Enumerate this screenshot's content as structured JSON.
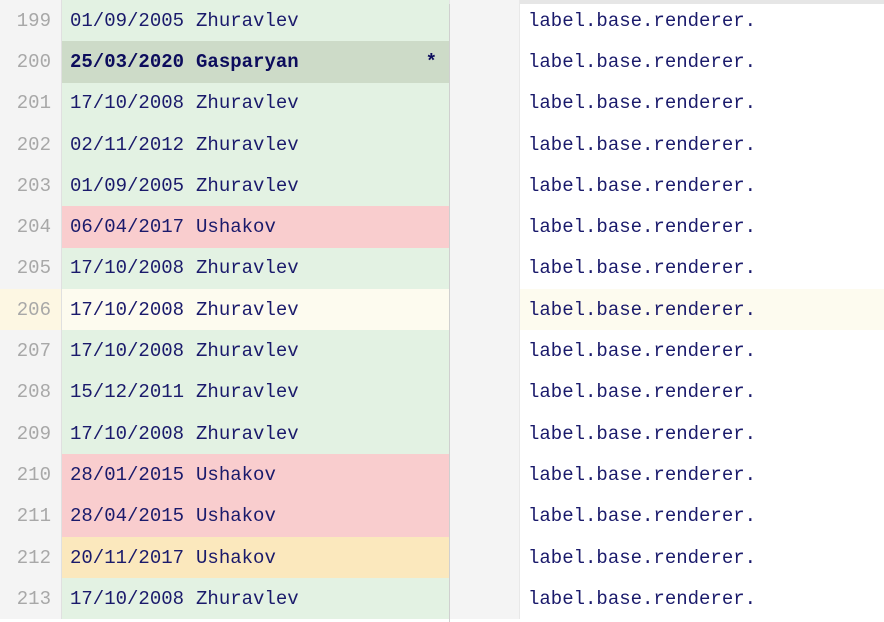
{
  "rows": [
    {
      "line": "199",
      "date": "01/09/2005",
      "author": "Zhuravlev",
      "annotColor": "green",
      "code": "label.base.renderer.",
      "current": false,
      "highlight": false
    },
    {
      "line": "200",
      "date": "25/03/2020",
      "author": "Gasparyan",
      "annotColor": "darkgreen",
      "code": "label.base.renderer.",
      "current": true,
      "highlight": false
    },
    {
      "line": "201",
      "date": "17/10/2008",
      "author": "Zhuravlev",
      "annotColor": "green",
      "code": "label.base.renderer.",
      "current": false,
      "highlight": false
    },
    {
      "line": "202",
      "date": "02/11/2012",
      "author": "Zhuravlev",
      "annotColor": "green",
      "code": "label.base.renderer.",
      "current": false,
      "highlight": false
    },
    {
      "line": "203",
      "date": "01/09/2005",
      "author": "Zhuravlev",
      "annotColor": "green",
      "code": "label.base.renderer.",
      "current": false,
      "highlight": false
    },
    {
      "line": "204",
      "date": "06/04/2017",
      "author": "Ushakov",
      "annotColor": "red",
      "code": "label.base.renderer.",
      "current": false,
      "highlight": false
    },
    {
      "line": "205",
      "date": "17/10/2008",
      "author": "Zhuravlev",
      "annotColor": "green",
      "code": "label.base.renderer.",
      "current": false,
      "highlight": false
    },
    {
      "line": "206",
      "date": "17/10/2008",
      "author": "Zhuravlev",
      "annotColor": "highlight",
      "code": "label.base.renderer.",
      "current": false,
      "highlight": true
    },
    {
      "line": "207",
      "date": "17/10/2008",
      "author": "Zhuravlev",
      "annotColor": "green",
      "code": "label.base.renderer.",
      "current": false,
      "highlight": false
    },
    {
      "line": "208",
      "date": "15/12/2011",
      "author": "Zhuravlev",
      "annotColor": "green",
      "code": "label.base.renderer.",
      "current": false,
      "highlight": false
    },
    {
      "line": "209",
      "date": "17/10/2008",
      "author": "Zhuravlev",
      "annotColor": "green",
      "code": "label.base.renderer.",
      "current": false,
      "highlight": false
    },
    {
      "line": "210",
      "date": "28/01/2015",
      "author": "Ushakov",
      "annotColor": "red",
      "code": "label.base.renderer.",
      "current": false,
      "highlight": false
    },
    {
      "line": "211",
      "date": "28/04/2015",
      "author": "Ushakov",
      "annotColor": "red",
      "code": "label.base.renderer.",
      "current": false,
      "highlight": false
    },
    {
      "line": "212",
      "date": "20/11/2017",
      "author": "Ushakov",
      "annotColor": "yellow",
      "code": "label.base.renderer.",
      "current": false,
      "highlight": false
    },
    {
      "line": "213",
      "date": "17/10/2008",
      "author": "Zhuravlev",
      "annotColor": "green",
      "code": "label.base.renderer.",
      "current": false,
      "highlight": false
    }
  ],
  "currentMarker": "*"
}
